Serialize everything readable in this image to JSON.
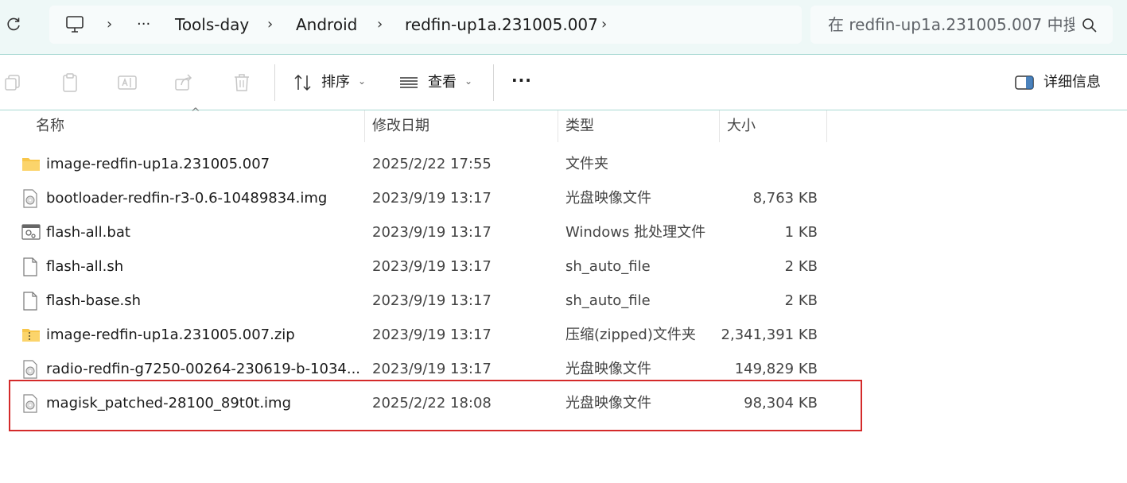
{
  "breadcrumb": {
    "overflow": "···",
    "items": [
      "Tools-day",
      "Android",
      "redfin-up1a.231005.007"
    ]
  },
  "search": {
    "placeholder": "在 redfin-up1a.231005.007 中搜"
  },
  "toolbar": {
    "sort_label": "排序",
    "view_label": "查看",
    "more_label": "···",
    "details_label": "详细信息"
  },
  "columns": {
    "name": "名称",
    "date": "修改日期",
    "type": "类型",
    "size": "大小"
  },
  "files": [
    {
      "name": "image-redfin-up1a.231005.007",
      "date": "2025/2/22 17:55",
      "type": "文件夹",
      "size": "",
      "icon": "folder-icon"
    },
    {
      "name": "bootloader-redfin-r3-0.6-10489834.img",
      "date": "2023/9/19 13:17",
      "type": "光盘映像文件",
      "size": "8,763 KB",
      "icon": "disc-image-file-icon"
    },
    {
      "name": "flash-all.bat",
      "date": "2023/9/19 13:17",
      "type": "Windows 批处理文件",
      "size": "1 KB",
      "icon": "batch-file-icon"
    },
    {
      "name": "flash-all.sh",
      "date": "2023/9/19 13:17",
      "type": "sh_auto_file",
      "size": "2 KB",
      "icon": "blank-file-icon"
    },
    {
      "name": "flash-base.sh",
      "date": "2023/9/19 13:17",
      "type": "sh_auto_file",
      "size": "2 KB",
      "icon": "blank-file-icon"
    },
    {
      "name": "image-redfin-up1a.231005.007.zip",
      "date": "2023/9/19 13:17",
      "type": "压缩(zipped)文件夹",
      "size": "2,341,391 KB",
      "icon": "zip-folder-icon"
    },
    {
      "name": "radio-redfin-g7250-00264-230619-b-1034...",
      "date": "2023/9/19 13:17",
      "type": "光盘映像文件",
      "size": "149,829 KB",
      "icon": "disc-image-file-icon"
    },
    {
      "name": "magisk_patched-28100_89t0t.img",
      "date": "2025/2/22 18:08",
      "type": "光盘映像文件",
      "size": "98,304 KB",
      "icon": "disc-image-file-icon"
    }
  ],
  "colors": {
    "accent_bg": "#eef8f7",
    "divider": "#a9d9d3",
    "highlight": "#d42a2a",
    "folder": "#f8c64a"
  }
}
